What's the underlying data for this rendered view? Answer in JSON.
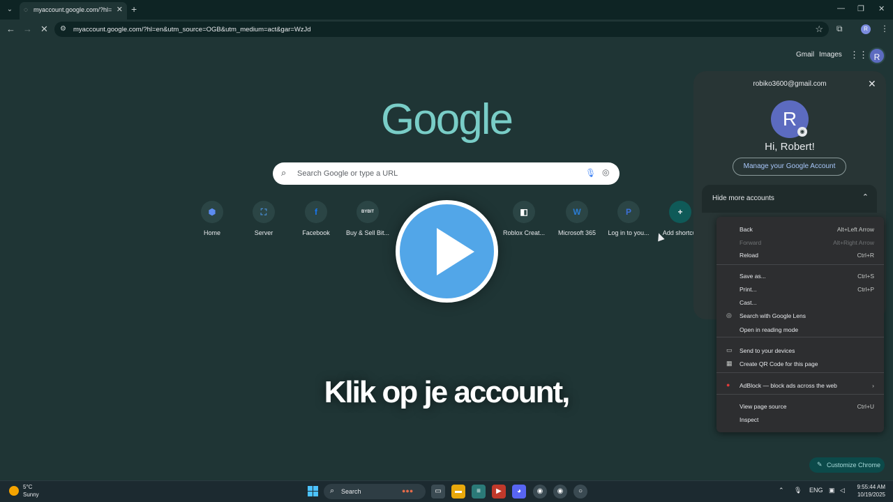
{
  "browser": {
    "tab_title": "myaccount.google.com/?hl=en",
    "url": "myaccount.google.com/?hl=en&utm_source=OGB&utm_medium=act&gar=WzJd"
  },
  "header_links": {
    "gmail": "Gmail",
    "images": "Images",
    "avatar_letter": "R"
  },
  "logo": "Google",
  "search": {
    "placeholder": "Search Google or type a URL"
  },
  "shortcuts": [
    {
      "label": "Home",
      "glyph": "⬢",
      "color": "#5c8cf0"
    },
    {
      "label": "Server",
      "glyph": "⛶",
      "color": "#4a90d9"
    },
    {
      "label": "Facebook",
      "glyph": "f",
      "color": "#1877f2"
    },
    {
      "label": "Buy & Sell Bit...",
      "glyph": "BYBIT",
      "color": "#e8eaed"
    },
    {
      "label": "Roblox Creat...",
      "glyph": "◧",
      "color": "#ffffff"
    },
    {
      "label": "Microsoft 365",
      "glyph": "W",
      "color": "#2b7cd3"
    },
    {
      "label": "Log in to you...",
      "glyph": "P",
      "color": "#3b6fd8"
    },
    {
      "label": "Add shortcut",
      "glyph": "+",
      "color": "#e8eaed"
    }
  ],
  "caption": "Klik op je account,",
  "account_panel": {
    "email": "robiko3600@gmail.com",
    "avatar_letter": "R",
    "greeting": "Hi, Robert!",
    "manage_label": "Manage your Google Account",
    "more_accounts_label": "Hide more accounts"
  },
  "context_menu": [
    {
      "label": "Back",
      "shortcut": "Alt+Left Arrow",
      "icon": "",
      "disabled": false
    },
    {
      "label": "Forward",
      "shortcut": "Alt+Right Arrow",
      "icon": "",
      "disabled": true
    },
    {
      "label": "Reload",
      "shortcut": "Ctrl+R",
      "icon": "",
      "disabled": false
    },
    {
      "label": "Save as...",
      "shortcut": "Ctrl+S",
      "icon": "",
      "disabled": false
    },
    {
      "label": "Print...",
      "shortcut": "Ctrl+P",
      "icon": "",
      "disabled": false
    },
    {
      "label": "Cast...",
      "shortcut": "",
      "icon": "",
      "disabled": false
    },
    {
      "label": "Search with Google Lens",
      "shortcut": "",
      "icon": "lens-icon",
      "disabled": false
    },
    {
      "label": "Open in reading mode",
      "shortcut": "",
      "icon": "",
      "disabled": false
    },
    {
      "label": "Send to your devices",
      "shortcut": "",
      "icon": "devices-icon",
      "disabled": false
    },
    {
      "label": "Create QR Code for this page",
      "shortcut": "",
      "icon": "qr-icon",
      "disabled": false
    },
    {
      "label": "AdBlock — block ads across the web",
      "shortcut": "",
      "icon": "adblock-icon",
      "disabled": false
    },
    {
      "label": "View page source",
      "shortcut": "Ctrl+U",
      "icon": "",
      "disabled": false
    },
    {
      "label": "Inspect",
      "shortcut": "",
      "icon": "",
      "disabled": false
    }
  ],
  "customize": "Customize Chrome",
  "taskbar": {
    "weather_temp": "5°C",
    "weather_cond": "Sunny",
    "search_label": "Search",
    "language": "ENG",
    "time": "9:55:44 AM",
    "date": "10/19/2025"
  }
}
